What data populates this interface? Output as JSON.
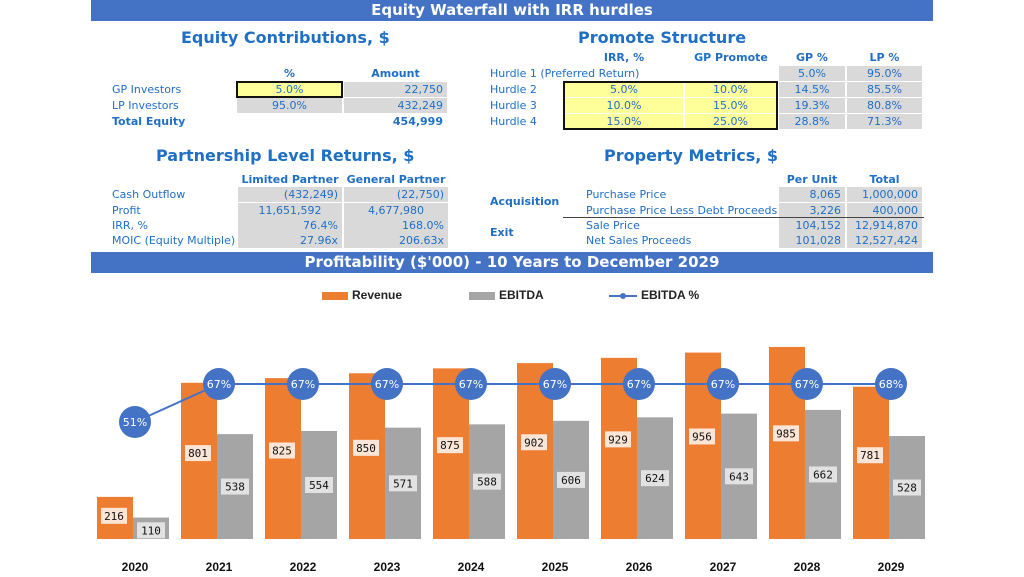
{
  "title": "Equity Waterfall with IRR hurdles",
  "equity_contributions": {
    "title": "Equity Contributions, $",
    "headers": [
      "%",
      "Amount"
    ],
    "rows": [
      {
        "label": "GP Investors",
        "pct": "5.0%",
        "amount": "22,750"
      },
      {
        "label": "LP Investors",
        "pct": "95.0%",
        "amount": "432,249"
      }
    ],
    "total": {
      "label": "Total Equity",
      "amount": "454,999"
    }
  },
  "promote_structure": {
    "title": "Promote Structure",
    "headers": [
      "IRR, %",
      "GP Promote",
      "GP %",
      "LP %"
    ],
    "rows": [
      {
        "label": "Hurdle 1 (Preferred Return)",
        "irr": "",
        "promote": "",
        "gp": "5.0%",
        "lp": "95.0%"
      },
      {
        "label": "Hurdle 2",
        "irr": "5.0%",
        "promote": "10.0%",
        "gp": "14.5%",
        "lp": "85.5%"
      },
      {
        "label": "Hurdle 3",
        "irr": "10.0%",
        "promote": "15.0%",
        "gp": "19.3%",
        "lp": "80.8%"
      },
      {
        "label": "Hurdle 4",
        "irr": "15.0%",
        "promote": "25.0%",
        "gp": "28.8%",
        "lp": "71.3%"
      }
    ]
  },
  "partnership_returns": {
    "title": "Partnership Level Returns, $",
    "headers": [
      "Limited Partner",
      "General Partner"
    ],
    "rows": [
      {
        "label": "Cash Outflow",
        "lp": "(432,249)",
        "gp": "(22,750)"
      },
      {
        "label": "Profit",
        "lp": "11,651,592",
        "gp": "4,677,980"
      },
      {
        "label": "IRR, %",
        "lp": "76.4%",
        "gp": "168.0%"
      },
      {
        "label": "MOIC (Equity Multiple)",
        "lp": "27.96x",
        "gp": "206.63x"
      }
    ]
  },
  "property_metrics": {
    "title": "Property Metrics, $",
    "headers": [
      "Per Unit",
      "Total"
    ],
    "groups": [
      "Acquisition",
      "Exit"
    ],
    "rows": [
      {
        "label": "Purchase Price",
        "per_unit": "8,065",
        "total": "1,000,000"
      },
      {
        "label": "Purchase Price Less Debt Proceeds",
        "per_unit": "3,226",
        "total": "400,000"
      },
      {
        "label": "Sale Price",
        "per_unit": "104,152",
        "total": "12,914,870"
      },
      {
        "label": "Net Sales Proceeds",
        "per_unit": "101,028",
        "total": "12,527,424"
      }
    ]
  },
  "profitability_banner": "Profitability ($'000) - 10 Years to December 2029",
  "colors": {
    "revenue": "#ed7d31",
    "ebitda": "#a5a5a5",
    "ebitda_pct": "#4472c4",
    "banner": "#4472c4",
    "text": "#1f6fc5"
  },
  "chart_data": {
    "type": "bar",
    "title": "Profitability ($'000) - 10 Years to December 2029",
    "categories": [
      "2020",
      "2021",
      "2022",
      "2023",
      "2024",
      "2025",
      "2026",
      "2027",
      "2028",
      "2029"
    ],
    "series": [
      {
        "name": "Revenue",
        "type": "bar",
        "values": [
          216,
          801,
          825,
          850,
          875,
          902,
          929,
          956,
          985,
          781
        ]
      },
      {
        "name": "EBITDA",
        "type": "bar",
        "values": [
          110,
          538,
          554,
          571,
          588,
          606,
          624,
          643,
          662,
          528
        ]
      },
      {
        "name": "EBITDA %",
        "type": "line",
        "values": [
          51,
          67,
          67,
          67,
          67,
          67,
          67,
          67,
          67,
          68
        ],
        "labels": [
          "51%",
          "67%",
          "67%",
          "67%",
          "67%",
          "67%",
          "67%",
          "67%",
          "67%",
          "68%"
        ]
      }
    ],
    "legend": [
      "Revenue",
      "EBITDA",
      "EBITDA %"
    ],
    "legend_position": "top",
    "xlabel": "",
    "ylabel": "",
    "ylim": [
      0,
      1000
    ],
    "grid": false
  }
}
